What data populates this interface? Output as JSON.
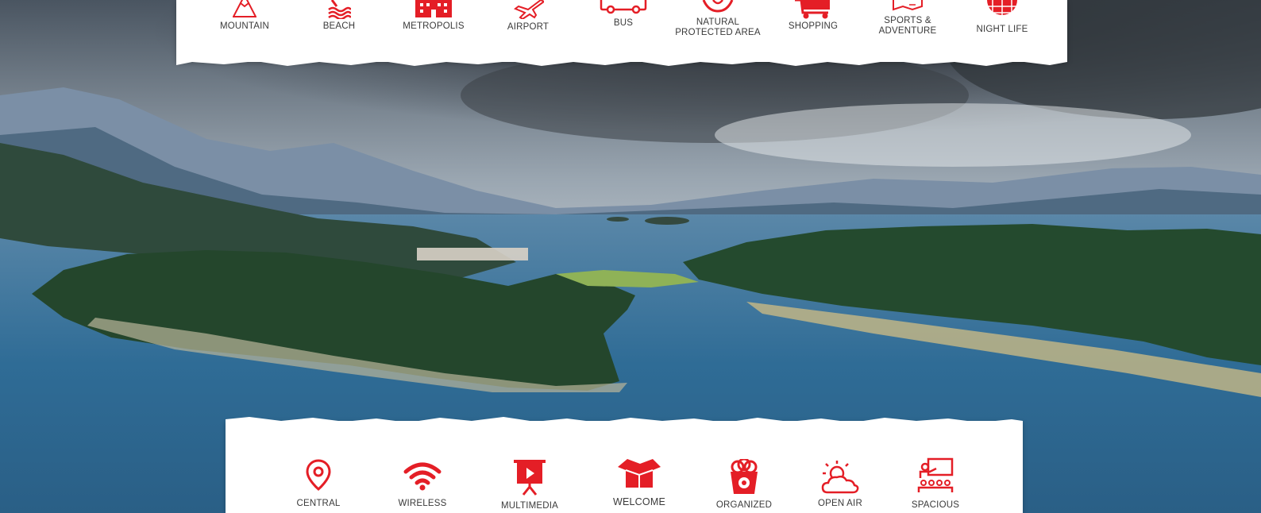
{
  "colors": {
    "accent": "#e41e26",
    "text": "#3a3a3a",
    "strip": "#ffffff"
  },
  "top_features": [
    {
      "id": "mountain",
      "label": "MOUNTAIN",
      "icon": "mountain-icon"
    },
    {
      "id": "beach",
      "label": "BEACH",
      "icon": "beach-icon"
    },
    {
      "id": "metropolis",
      "label": "METROPOLIS",
      "icon": "building-icon"
    },
    {
      "id": "airport",
      "label": "AIRPORT",
      "icon": "airplane-icon"
    },
    {
      "id": "bus",
      "label": "BUS",
      "icon": "bus-icon"
    },
    {
      "id": "natural",
      "label": "NATURAL PROTECTED AREA",
      "icon": "leaf-hands-icon"
    },
    {
      "id": "shopping",
      "label": "SHOPPING",
      "icon": "shopping-cart-icon"
    },
    {
      "id": "sports",
      "label": "SPORTS & ADVENTURE",
      "icon": "map-icon"
    },
    {
      "id": "nightlife",
      "label": "NIGHT LIFE",
      "icon": "disco-ball-icon"
    }
  ],
  "bottom_features": [
    {
      "id": "central",
      "label": "CENTRAL",
      "icon": "location-pin-icon"
    },
    {
      "id": "wireless",
      "label": "WIRELESS",
      "icon": "wifi-icon"
    },
    {
      "id": "multimedia",
      "label": "MULTIMEDIA",
      "icon": "projector-screen-icon"
    },
    {
      "id": "welcome",
      "label": "WELCOME",
      "icon": "open-box-icon"
    },
    {
      "id": "organized",
      "label": "ORGANIZED",
      "icon": "popcorn-icon"
    },
    {
      "id": "openair",
      "label": "OPEN AIR",
      "icon": "sun-cloud-icon"
    },
    {
      "id": "spacious",
      "label": "SPACIOUS",
      "icon": "classroom-icon"
    }
  ]
}
